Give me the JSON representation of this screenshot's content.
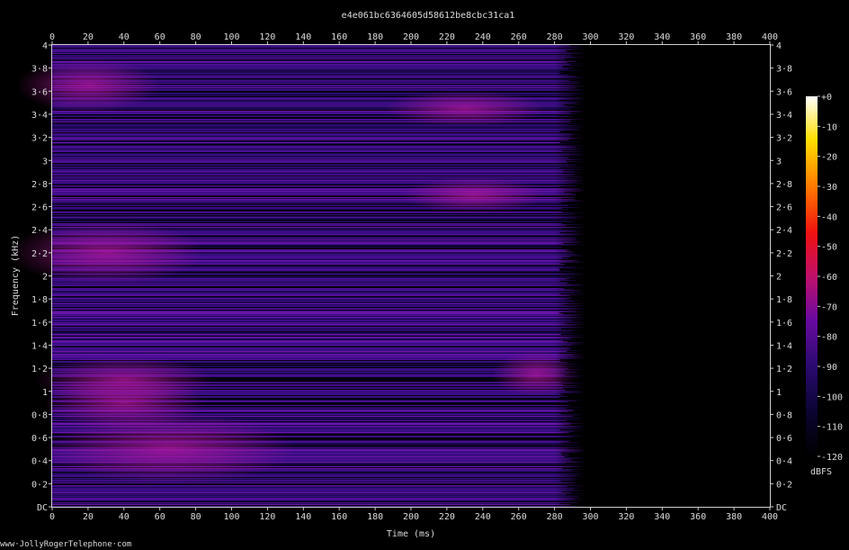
{
  "chart_data": {
    "type": "heatmap",
    "title": "e4e061bc6364605d58612be8cbc31ca1",
    "xlabel": "Time (ms)",
    "ylabel": "Frequency (kHz)",
    "xlim": [
      0,
      400
    ],
    "ylim": [
      0,
      4
    ],
    "x_ticks": [
      "0",
      "20",
      "40",
      "60",
      "80",
      "100",
      "120",
      "140",
      "160",
      "180",
      "200",
      "220",
      "240",
      "260",
      "280",
      "300",
      "320",
      "340",
      "360",
      "380",
      "400"
    ],
    "y_ticks": [
      "DC",
      "0·2",
      "0·4",
      "0·6",
      "0·8",
      "1",
      "1·2",
      "1·4",
      "1·6",
      "1·8",
      "2",
      "2·2",
      "2·4",
      "2·6",
      "2·8",
      "3",
      "3·2",
      "3·4",
      "3·6",
      "3·8",
      "4"
    ],
    "colorbar": {
      "label": "dBFS",
      "ticks": [
        "+0",
        "-10",
        "-20",
        "-30",
        "-40",
        "-50",
        "-60",
        "-70",
        "-80",
        "-90",
        "-100",
        "-110",
        "-120"
      ],
      "range": [
        -120,
        0
      ]
    },
    "signal_end_ms": 295,
    "typical_level_dbfs": -95,
    "peak_region": {
      "x_ms": [
        30,
        100
      ],
      "y_khz": [
        0.35,
        0.65
      ],
      "level_dbfs": -85
    },
    "background_level_dbfs": -120
  },
  "footer": {
    "credit": "www·JollyRogerTelephone·com"
  }
}
